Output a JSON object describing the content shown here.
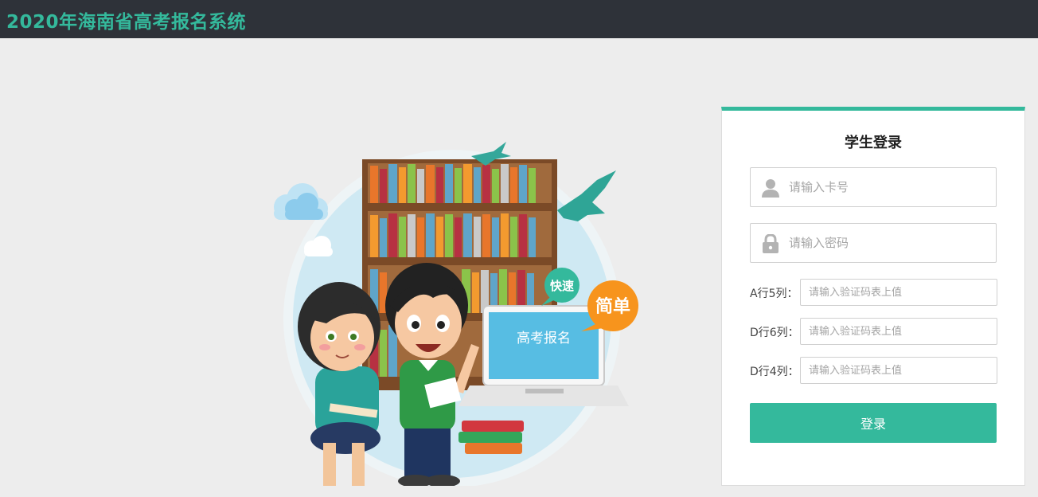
{
  "header": {
    "title": "2020年海南省高考报名系统"
  },
  "illustration": {
    "screen_text": "高考报名",
    "bubble_fast": "快速",
    "bubble_simple": "简单"
  },
  "login": {
    "title": "学生登录",
    "card_placeholder": "请输入卡号",
    "password_placeholder": "请输入密码",
    "code_rows": [
      {
        "label": "A行5列：",
        "placeholder": "请输入验证码表上值"
      },
      {
        "label": "D行6列：",
        "placeholder": "请输入验证码表上值"
      },
      {
        "label": "D行4列：",
        "placeholder": "请输入验证码表上值"
      }
    ],
    "submit_label": "登录"
  },
  "colors": {
    "accent": "#34b99c",
    "header_bg": "#2e3239",
    "page_bg": "#ededed"
  },
  "icons": {
    "user_field": "user-icon",
    "password_field": "lock-icon"
  }
}
